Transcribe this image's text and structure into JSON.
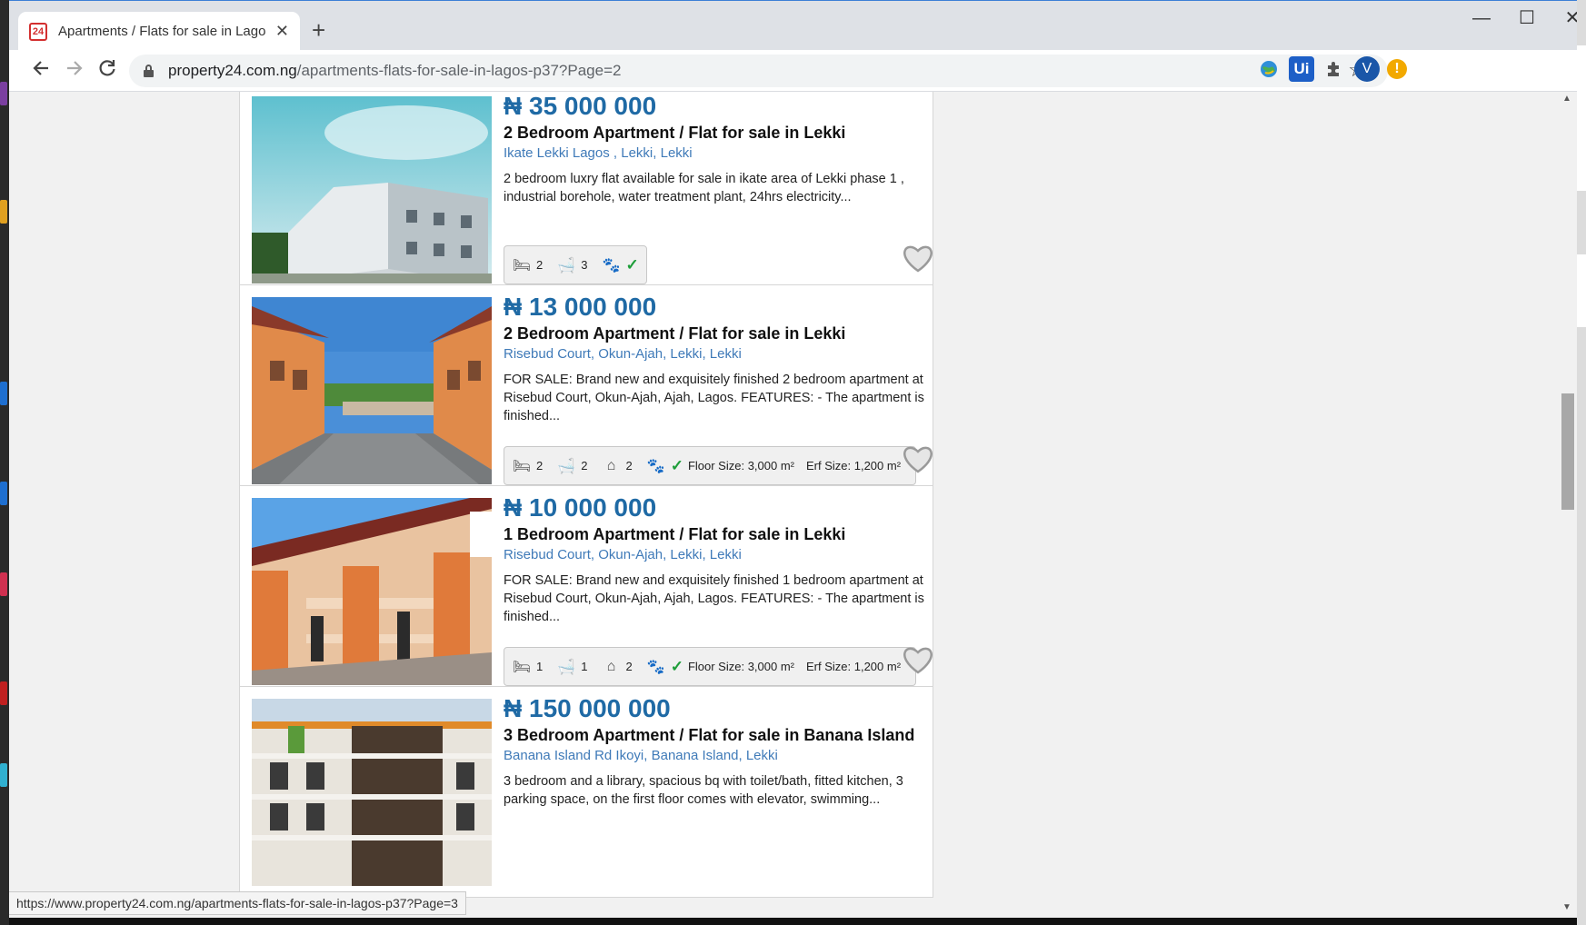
{
  "browser": {
    "tab": {
      "favicon_text": "24",
      "title": "Apartments / Flats for sale in Lagos"
    },
    "address": {
      "host": "property24.com.ng",
      "path": "/apartments-flats-for-sale-in-lagos-p37?Page=2"
    },
    "profile_initial": "V",
    "status_url": "https://www.property24.com.ng/apartments-flats-for-sale-in-lagos-p37?Page=3",
    "icons": {
      "back": "arrow-left-icon",
      "forward": "arrow-right-icon",
      "reload": "reload-icon",
      "star": "star-icon",
      "extensions": "puzzle-icon"
    },
    "colors": {
      "accent": "#1f6aa5",
      "link": "#3f7ab8",
      "check": "#1e9e3a"
    }
  },
  "listings": [
    {
      "price": "₦ 35 000 000",
      "title": "2 Bedroom Apartment / Flat for sale in Lekki",
      "location": "Ikate Lekki Lagos , Lekki, Lekki",
      "description": "2 bedroom luxry flat available for sale in ikate area of Lekki phase 1 , industrial borehole, water treatment plant, 24hrs electricity...",
      "bedrooms": "2",
      "bathrooms": "3",
      "garages": "",
      "floor_size": "",
      "erf_size": ""
    },
    {
      "price": "₦ 13 000 000",
      "title": "2 Bedroom Apartment / Flat for sale in Lekki",
      "location": "Risebud Court, Okun-Ajah, Lekki, Lekki",
      "description": "FOR SALE: Brand new and exquisitely finished 2 bedroom apartment at Risebud Court, Okun-Ajah, Ajah, Lagos. FEATURES: - The apartment is finished...",
      "bedrooms": "2",
      "bathrooms": "2",
      "garages": "2",
      "floor_size": "Floor Size: 3,000 m²",
      "erf_size": "Erf Size: 1,200 m²"
    },
    {
      "price": "₦ 10 000 000",
      "title": "1 Bedroom Apartment / Flat for sale in Lekki",
      "location": "Risebud Court, Okun-Ajah, Lekki, Lekki",
      "description": "FOR SALE: Brand new and exquisitely finished 1 bedroom apartment at Risebud Court, Okun-Ajah, Ajah, Lagos. FEATURES: - The apartment is finished...",
      "bedrooms": "1",
      "bathrooms": "1",
      "garages": "2",
      "floor_size": "Floor Size: 3,000 m²",
      "erf_size": "Erf Size: 1,200 m²"
    },
    {
      "price": "₦ 150 000 000",
      "title": "3 Bedroom Apartment / Flat for sale in Banana Island",
      "location": "Banana Island Rd Ikoyi, Banana Island, Lekki",
      "description": "3 bedroom and a library, spacious bq with toilet/bath, fitted kitchen, 3 parking space, on the first floor comes with elevator, swimming..."
    }
  ]
}
